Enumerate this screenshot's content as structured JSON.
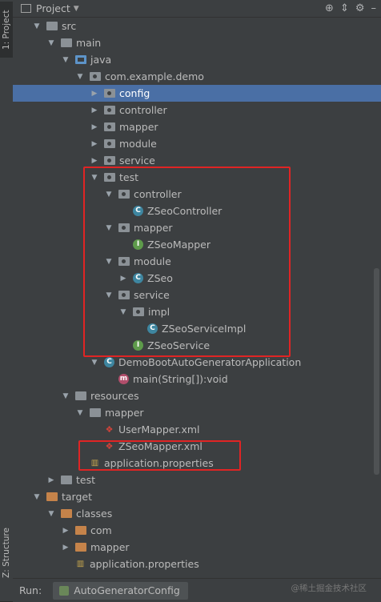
{
  "side_tabs": {
    "project": "1: Project",
    "structure": "Z: Structure"
  },
  "header": {
    "title": "Project"
  },
  "tree": [
    {
      "label": "src",
      "level": 0,
      "arrow": "down",
      "icon": "folder"
    },
    {
      "label": "main",
      "level": 1,
      "arrow": "down",
      "icon": "folder"
    },
    {
      "label": "java",
      "level": 2,
      "arrow": "down",
      "icon": "folder-blue"
    },
    {
      "label": "com.example.demo",
      "level": 3,
      "arrow": "down",
      "icon": "package"
    },
    {
      "label": "config",
      "level": 4,
      "arrow": "right",
      "icon": "package",
      "selected": true
    },
    {
      "label": "controller",
      "level": 4,
      "arrow": "right",
      "icon": "package"
    },
    {
      "label": "mapper",
      "level": 4,
      "arrow": "right",
      "icon": "package"
    },
    {
      "label": "module",
      "level": 4,
      "arrow": "right",
      "icon": "package"
    },
    {
      "label": "service",
      "level": 4,
      "arrow": "right",
      "icon": "package"
    },
    {
      "label": "test",
      "level": 4,
      "arrow": "down",
      "icon": "package"
    },
    {
      "label": "controller",
      "level": 5,
      "arrow": "down",
      "icon": "package"
    },
    {
      "label": "ZSeoController",
      "level": 6,
      "arrow": "none",
      "icon": "class"
    },
    {
      "label": "mapper",
      "level": 5,
      "arrow": "down",
      "icon": "package"
    },
    {
      "label": "ZSeoMapper",
      "level": 6,
      "arrow": "none",
      "icon": "interface"
    },
    {
      "label": "module",
      "level": 5,
      "arrow": "down",
      "icon": "package"
    },
    {
      "label": "ZSeo",
      "level": 6,
      "arrow": "right",
      "icon": "class"
    },
    {
      "label": "service",
      "level": 5,
      "arrow": "down",
      "icon": "package"
    },
    {
      "label": "impl",
      "level": 6,
      "arrow": "down",
      "icon": "package"
    },
    {
      "label": "ZSeoServiceImpl",
      "level": 7,
      "arrow": "none",
      "icon": "class"
    },
    {
      "label": "ZSeoService",
      "level": 6,
      "arrow": "none",
      "icon": "interface"
    },
    {
      "label": "DemoBootAutoGeneratorApplication",
      "level": 4,
      "arrow": "down",
      "icon": "spring-class"
    },
    {
      "label": "main(String[]):void",
      "level": 5,
      "arrow": "none",
      "icon": "method"
    },
    {
      "label": "resources",
      "level": 2,
      "arrow": "down",
      "icon": "folder-res"
    },
    {
      "label": "mapper",
      "level": 3,
      "arrow": "down",
      "icon": "folder"
    },
    {
      "label": "UserMapper.xml",
      "level": 4,
      "arrow": "none",
      "icon": "xml"
    },
    {
      "label": "ZSeoMapper.xml",
      "level": 4,
      "arrow": "none",
      "icon": "xml"
    },
    {
      "label": "application.properties",
      "level": 3,
      "arrow": "none",
      "icon": "properties"
    },
    {
      "label": "test",
      "level": 1,
      "arrow": "right",
      "icon": "folder"
    },
    {
      "label": "target",
      "level": 0,
      "arrow": "down",
      "icon": "folder-orange"
    },
    {
      "label": "classes",
      "level": 1,
      "arrow": "down",
      "icon": "folder-orange"
    },
    {
      "label": "com",
      "level": 2,
      "arrow": "right",
      "icon": "folder-orange"
    },
    {
      "label": "mapper",
      "level": 2,
      "arrow": "right",
      "icon": "folder-orange"
    },
    {
      "label": "application.properties",
      "level": 2,
      "arrow": "none",
      "icon": "properties"
    }
  ],
  "bottom": {
    "run_label": "Run:",
    "tab_label": "AutoGeneratorConfig"
  },
  "watermark": "@稀土掘金技术社区",
  "colors": {
    "selection": "#4a6fa5",
    "highlight_box": "#e02424",
    "background": "#3c3f41"
  }
}
